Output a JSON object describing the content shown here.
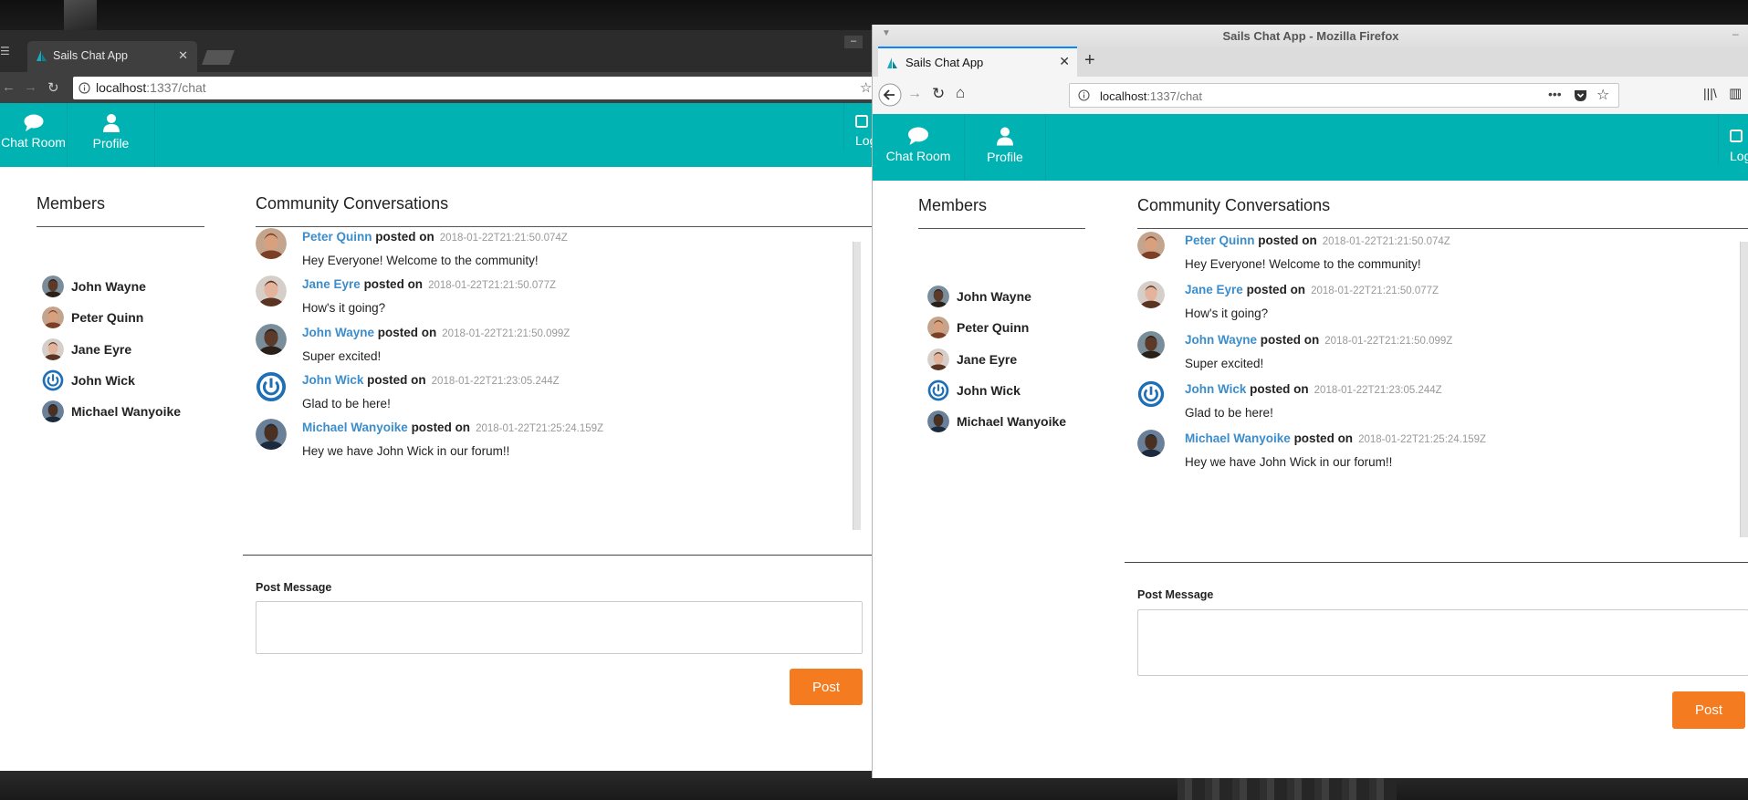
{
  "colors": {
    "accent": "#00b2b2",
    "link": "#3c8dcb",
    "button": "#f47b20"
  },
  "app": {
    "nav": {
      "chat_room": "Chat Room",
      "profile": "Profile",
      "logout": "Log"
    },
    "members_title": "Members",
    "members": [
      {
        "name": "John Wayne",
        "avatar": "john-wayne"
      },
      {
        "name": "Peter Quinn",
        "avatar": "peter-quinn"
      },
      {
        "name": "Jane Eyre",
        "avatar": "jane-eyre"
      },
      {
        "name": "John Wick",
        "avatar": "power-icon"
      },
      {
        "name": "Michael Wanyoike",
        "avatar": "michael-wanyoike"
      }
    ],
    "conversations_title": "Community Conversations",
    "posted_on": "posted on",
    "messages": [
      {
        "author": "Peter Quinn",
        "time": "2018-01-22T21:21:50.074Z",
        "text": "Hey Everyone! Welcome to the community!"
      },
      {
        "author": "Jane Eyre",
        "time": "2018-01-22T21:21:50.077Z",
        "text": "How's it going?"
      },
      {
        "author": "John Wayne",
        "time": "2018-01-22T21:21:50.099Z",
        "text": "Super excited!"
      },
      {
        "author": "John Wick",
        "time": "2018-01-22T21:23:05.244Z",
        "text": "Glad to be here!"
      },
      {
        "author": "Michael Wanyoike",
        "time": "2018-01-22T21:25:24.159Z",
        "text": "Hey we have John Wick in our forum!!"
      }
    ],
    "post_label": "Post Message",
    "post_button": "Post"
  },
  "chrome": {
    "tab_title": "Sails Chat App",
    "url_host": "localhost",
    "url_path": ":1337/chat"
  },
  "firefox": {
    "window_title": "Sails Chat App - Mozilla Firefox",
    "tab_title": "Sails Chat App",
    "url_host": "localhost",
    "url_path": ":1337/chat"
  }
}
